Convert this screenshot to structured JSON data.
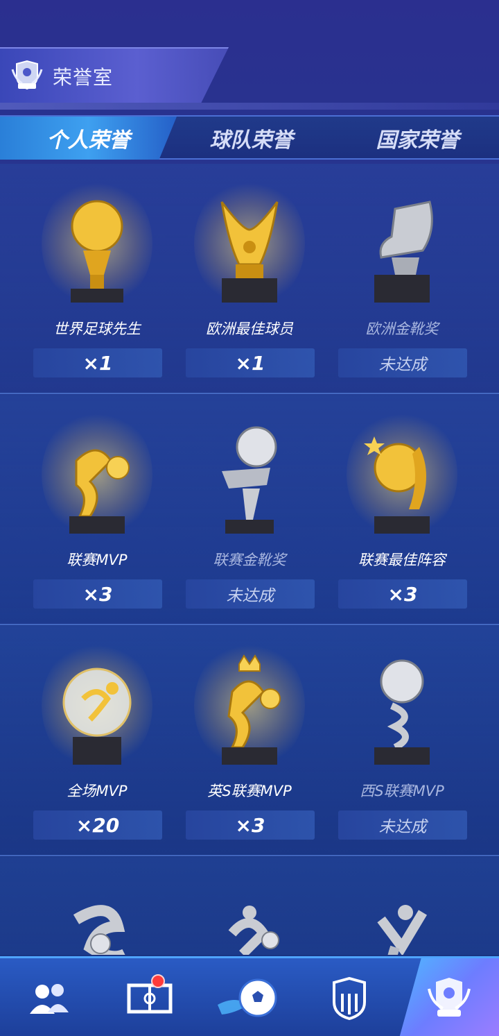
{
  "header": {
    "title": "荣誉室",
    "emblem_icon": "trophy-shield-icon"
  },
  "tabs": [
    {
      "label": "个人荣誉",
      "active": true
    },
    {
      "label": "球队荣誉",
      "active": false
    },
    {
      "label": "国家荣誉",
      "active": false
    }
  ],
  "honors": [
    {
      "name": "世界足球先生",
      "status": "×1",
      "achieved": true,
      "trophy_icon": "gold-ball-trophy-icon"
    },
    {
      "name": "欧洲最佳球员",
      "status": "×1",
      "achieved": true,
      "trophy_icon": "gold-hand-trophy-icon"
    },
    {
      "name": "欧洲金靴奖",
      "status": "未达成",
      "achieved": false,
      "trophy_icon": "silver-boot-trophy-icon"
    },
    {
      "name": "联赛MVP",
      "status": "×3",
      "achieved": true,
      "trophy_icon": "gold-player-trophy-icon"
    },
    {
      "name": "联赛金靴奖",
      "status": "未达成",
      "achieved": false,
      "trophy_icon": "silver-ball-boot-trophy-icon"
    },
    {
      "name": "联赛最佳阵容",
      "status": "×3",
      "achieved": true,
      "trophy_icon": "gold-stars-trophy-icon"
    },
    {
      "name": "全场MVP",
      "status": "×20",
      "achieved": true,
      "trophy_icon": "crystal-globe-trophy-icon"
    },
    {
      "name": "英S联赛MVP",
      "status": "×3",
      "achieved": true,
      "trophy_icon": "gold-crown-player-trophy-icon"
    },
    {
      "name": "西S联赛MVP",
      "status": "未达成",
      "achieved": false,
      "trophy_icon": "silver-spiral-trophy-icon"
    },
    {
      "name": "",
      "status": "",
      "achieved": false,
      "trophy_icon": "silver-swirl-trophy-icon"
    },
    {
      "name": "",
      "status": "",
      "achieved": false,
      "trophy_icon": "silver-player-trophy-icon"
    },
    {
      "name": "",
      "status": "",
      "achieved": false,
      "trophy_icon": "silver-figure-trophy-icon"
    }
  ],
  "bottom_nav": [
    {
      "icon": "team-players-icon",
      "active": false,
      "has_badge": false
    },
    {
      "icon": "pitch-tactics-icon",
      "active": false,
      "has_badge": true
    },
    {
      "icon": "football-icon",
      "active": false,
      "has_badge": false
    },
    {
      "icon": "club-shield-icon",
      "active": false,
      "has_badge": false
    },
    {
      "icon": "trophy-shield-icon",
      "active": true,
      "has_badge": false
    }
  ],
  "colors": {
    "gold": "#f2c23a",
    "silver": "#c9ccd3",
    "accent": "#3ea0f0"
  }
}
